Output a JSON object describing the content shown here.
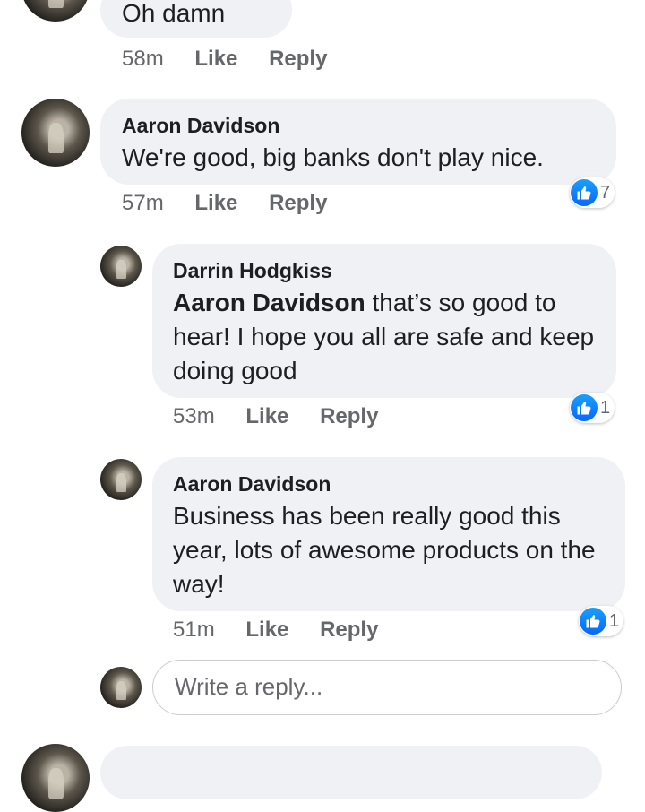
{
  "comments": [
    {
      "text": "Oh damn",
      "time": "58m",
      "like": "Like",
      "reply": "Reply"
    },
    {
      "author": "Aaron Davidson",
      "text": "We're good, big banks don't play nice.",
      "time": "57m",
      "like": "Like",
      "reply": "Reply",
      "reaction_count": "7"
    },
    {
      "author": "Darrin Hodgkiss",
      "mention": "Aaron Davidson",
      "text": " that’s so good to hear! I hope you all are safe and keep doing good",
      "time": "53m",
      "like": "Like",
      "reply": "Reply",
      "reaction_count": "1"
    },
    {
      "author": "Aaron Davidson",
      "text": "Business has been really good this year, lots of awesome products on the way!",
      "time": "51m",
      "like": "Like",
      "reply": "Reply",
      "reaction_count": "1"
    }
  ],
  "reply_input": {
    "placeholder": "Write a reply..."
  },
  "icons": {
    "reaction": "thumbs-up-icon"
  },
  "colors": {
    "bubble": "#f0f1f4",
    "like_blue": "#0866ff",
    "meta_gray": "#65676b"
  }
}
